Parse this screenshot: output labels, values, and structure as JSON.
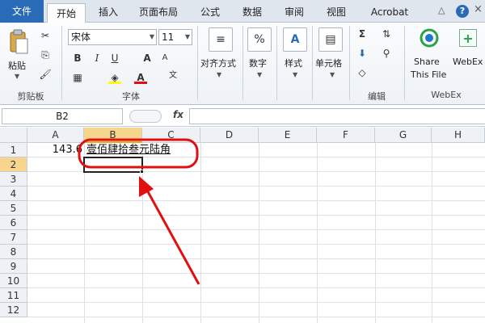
{
  "tabs": {
    "file": "文件",
    "home": "开始",
    "insert": "插入",
    "page_layout": "页面布局",
    "formulas": "公式",
    "data": "数据",
    "review": "审阅",
    "view": "视图",
    "acrobat": "Acrobat"
  },
  "window_controls": {
    "minimize_ribbon": "△",
    "help": "?",
    "close": "×"
  },
  "ribbon": {
    "clipboard": {
      "paste_label": "粘贴",
      "group_label": "剪贴板"
    },
    "font": {
      "font_name": "宋体",
      "font_size": "11",
      "bold": "B",
      "italic": "I",
      "underline": "U",
      "grow": "A",
      "shrink": "A",
      "font_color": "A",
      "group_label": "字体"
    },
    "alignment": {
      "label": "对齐方式"
    },
    "number": {
      "label": "数字",
      "icon_text": "%"
    },
    "styles": {
      "label": "样式"
    },
    "cells": {
      "label": "单元格"
    },
    "editing": {
      "group_label": "编辑"
    },
    "webex": {
      "share_label_1": "Share",
      "share_label_2": "This File",
      "webex_label": "WebEx",
      "group_label": "WebEx"
    }
  },
  "formula_bar": {
    "name_box": "B2",
    "fx": "fx",
    "content": ""
  },
  "sheet": {
    "columns": [
      "A",
      "B",
      "C",
      "D",
      "E",
      "F",
      "G",
      "H"
    ],
    "rows": [
      "1",
      "2",
      "3",
      "4",
      "5",
      "6",
      "7",
      "8",
      "9",
      "10",
      "11",
      "12"
    ],
    "selected_column": "B",
    "selected_row": "2",
    "cells": {
      "A1": "143.6",
      "B1": "壹佰肆拾叁元陆角"
    }
  },
  "annotation": {
    "highlight_color": "#e01010"
  },
  "colors": {
    "file_tab": "#2a6bb7",
    "selected_header": "#f8d58c"
  }
}
